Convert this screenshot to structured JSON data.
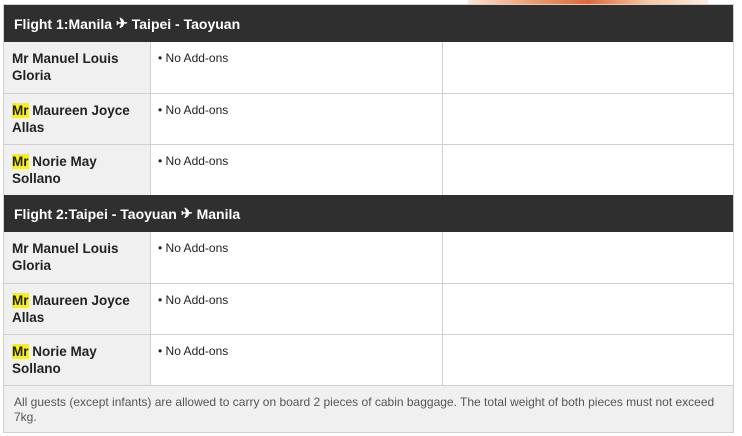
{
  "flights": [
    {
      "prefix": "Flight 1: ",
      "origin": "Manila",
      "destination": "Taipei - Taoyuan",
      "passengers": [
        {
          "title": "Mr",
          "name": " Manuel Louis Gloria",
          "highlight": false,
          "addons": "No Add-ons"
        },
        {
          "title": "Mr",
          "name": " Maureen Joyce Allas",
          "highlight": true,
          "addons": "No Add-ons"
        },
        {
          "title": "Mr",
          "name": " Norie May Sollano",
          "highlight": true,
          "addons": "No Add-ons"
        }
      ]
    },
    {
      "prefix": "Flight 2: ",
      "origin": "Taipei - Taoyuan",
      "destination": "Manila",
      "passengers": [
        {
          "title": "Mr",
          "name": " Manuel Louis Gloria",
          "highlight": false,
          "addons": "No Add-ons"
        },
        {
          "title": "Mr",
          "name": " Maureen Joyce Allas",
          "highlight": true,
          "addons": "No Add-ons"
        },
        {
          "title": "Mr",
          "name": " Norie May Sollano",
          "highlight": true,
          "addons": "No Add-ons"
        }
      ]
    }
  ],
  "bullet": "•",
  "plane_icon": "✈",
  "note": "All guests (except infants) are allowed to carry on board 2 pieces of cabin baggage. The total weight of both pieces must not exceed 7kg.",
  "colors": {
    "header_bg": "#2f2f2f",
    "highlight": "#f5f01e",
    "name_cell_bg": "#f0f0f0"
  }
}
